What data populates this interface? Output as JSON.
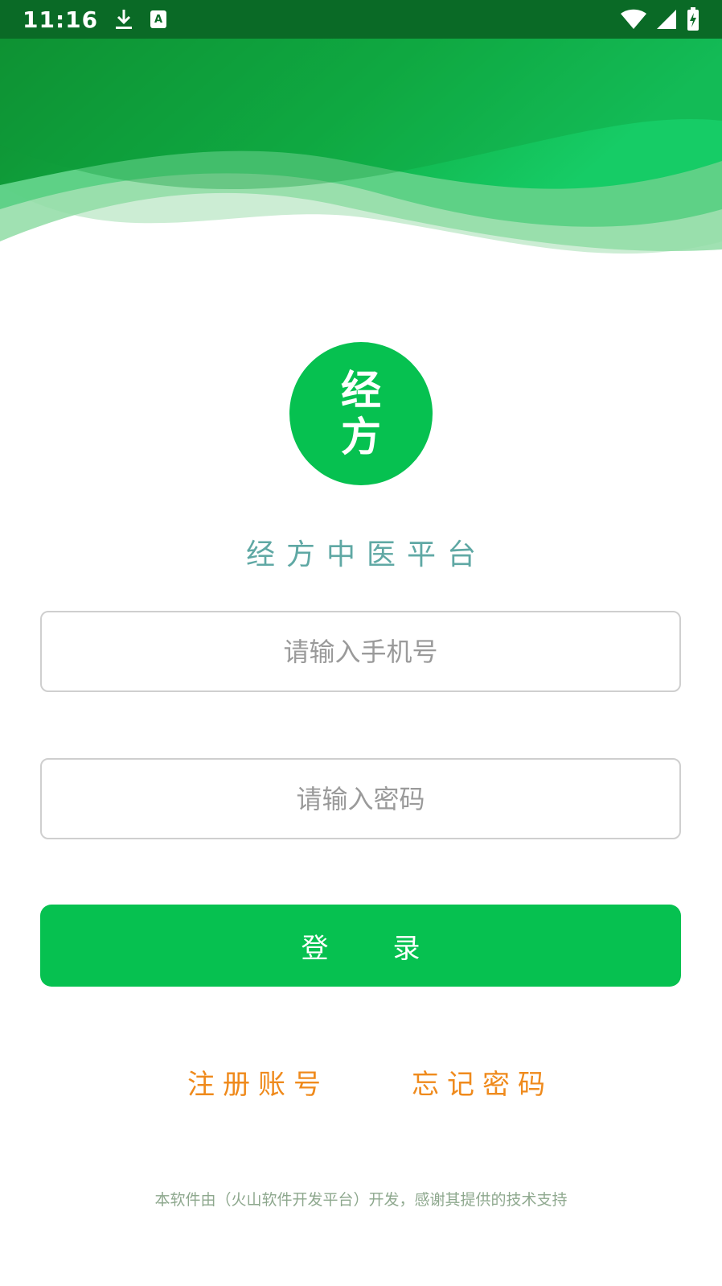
{
  "status_bar": {
    "time": "11:16",
    "icons": [
      "download-icon",
      "accessibility-a-icon",
      "wifi-icon",
      "cell-signal-icon",
      "battery-charging-icon"
    ]
  },
  "logo": {
    "line1": "经",
    "line2": "方"
  },
  "app_name": "经方中医平台",
  "form": {
    "phone_placeholder": "请输入手机号",
    "password_placeholder": "请输入密码",
    "login_label": "登录"
  },
  "links": {
    "register": "注册账号",
    "forgot_password": "忘记密码"
  },
  "footer": "本软件由（火山软件开发平台）开发，感谢其提供的技术支持",
  "colors": {
    "brand_green": "#06c150",
    "status_bar": "#0a6a26",
    "app_name_text": "#5fa8a4",
    "link_orange": "#ef8a1c",
    "footer_text": "#8ea88e"
  }
}
